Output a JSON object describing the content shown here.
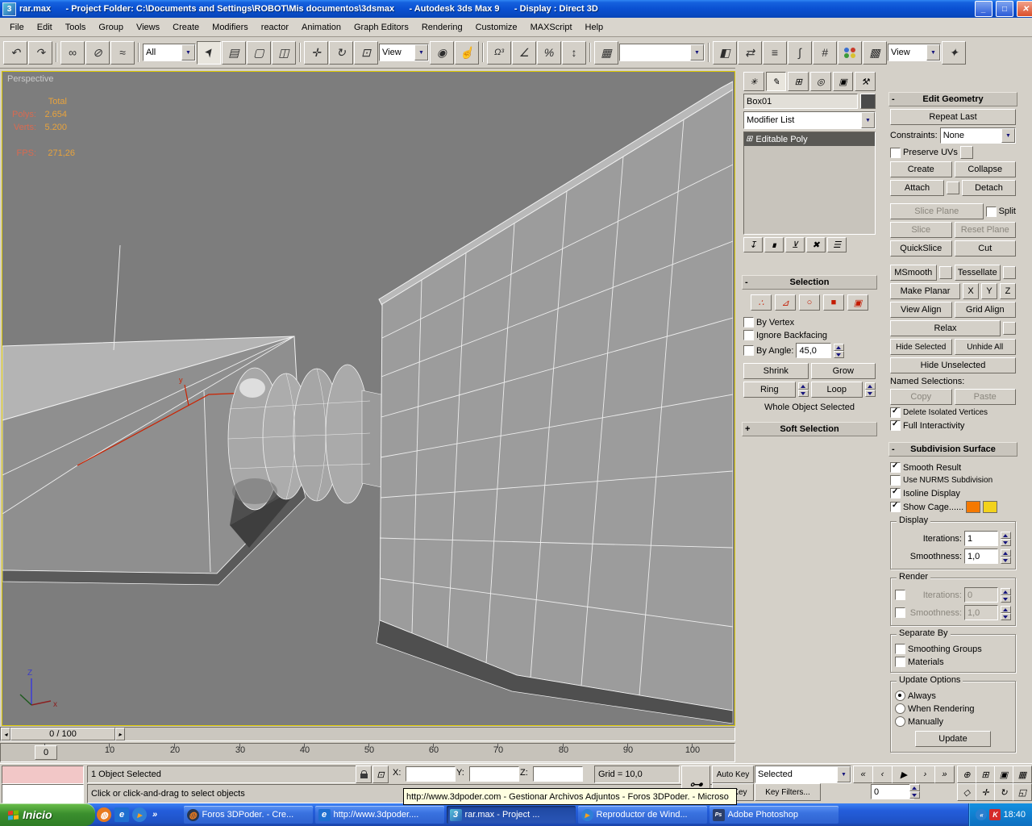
{
  "window": {
    "title": "rar.max      - Project Folder: C:\\Documents and Settings\\ROBOT\\Mis documentos\\3dsmax      - Autodesk 3ds Max 9      - Display : Direct 3D"
  },
  "icons": {
    "app": "3",
    "minimize": "_",
    "maximize": "□",
    "close": "✕",
    "undo": "↶",
    "redo": "↷",
    "select_link": "∞",
    "unlink": "⊘",
    "bind_spacewarp": "≈",
    "select": "➤",
    "select_by_name": "▤",
    "region": "▢",
    "window_crossing": "◫",
    "move": "✛",
    "rotate": "↻",
    "scale": "⊡",
    "use_center": "◉",
    "manipulate": "☝",
    "snap": "Ω³",
    "angle_snap": "∠",
    "percent_snap": "%",
    "spinner_snap": "↕",
    "named_sets": "▦",
    "mirror": "◧",
    "align": "⇄",
    "layers": "≡",
    "curve_editor": "∫",
    "schematic": "#",
    "render_setup": "▩",
    "quick_render": "✦",
    "arrow": "▼",
    "tab_create": "✳",
    "tab_modify": "✎",
    "tab_hierarchy": "⊞",
    "tab_motion": "◎",
    "tab_display": "▣",
    "tab_utilities": "⚒",
    "pin_stack": "↧",
    "show_end_result": "∎",
    "make_unique": "⊻",
    "remove_modifier": "✖",
    "configure_sets": "☰",
    "stack_item_icon": "⊞",
    "so_vertex": "∴",
    "so_edge": "⊿",
    "so_border": "○",
    "so_polygon": "■",
    "so_element": "▣",
    "go_start": "«",
    "prev_frame": "‹",
    "play": "▶",
    "next_frame": "›",
    "go_end": "»",
    "zoom": "⊕",
    "zoom_all": "⊞",
    "zoom_extents": "▣",
    "zoom_extents_all": "▦",
    "fov": "◇",
    "pan": "✛",
    "arc_rotate": "↻",
    "min_max": "◱",
    "set_key_glyph": "⊶",
    "absolute_mode": "⊡",
    "slider_left": "◂",
    "slider_right": "▸",
    "tray_chevron": "«",
    "quick_chevron": "»",
    "ie": "e",
    "wmp": "▸",
    "ps": "Ps",
    "max_app": "3",
    "ff": "◍",
    "red_k": "K"
  },
  "menubar": {
    "items": [
      "File",
      "Edit",
      "Tools",
      "Group",
      "Views",
      "Create",
      "Modifiers",
      "reactor",
      "Animation",
      "Graph Editors",
      "Rendering",
      "Customize",
      "MAXScript",
      "Help"
    ]
  },
  "toolbar": {
    "selection_filter": "All",
    "coordsys": "View",
    "named_selection": "",
    "render_type": "View"
  },
  "viewport": {
    "label": "Perspective",
    "stats": {
      "total_label": "Total",
      "polys_label": "Polys:",
      "polys_value": "2.654",
      "verts_label": "Verts:",
      "verts_value": "5.200",
      "fps_label": "FPS:",
      "fps_value": "271,26"
    },
    "axis": {
      "x": "x",
      "y": "y",
      "z": "Z"
    }
  },
  "command_panel": {
    "object_name": "Box01",
    "modifier_list": "Modifier List",
    "stack_item": "Editable Poly",
    "selection": {
      "title": "Selection",
      "by_vertex": "By Vertex",
      "ignore_backfacing": "Ignore Backfacing",
      "by_angle": "By Angle:",
      "angle_value": "45,0",
      "shrink": "Shrink",
      "grow": "Grow",
      "ring": "Ring",
      "loop": "Loop",
      "status": "Whole Object Selected"
    },
    "soft_selection": {
      "title": "Soft Selection"
    },
    "edit_geometry": {
      "title": "Edit Geometry",
      "repeat_last": "Repeat Last",
      "constraints_label": "Constraints:",
      "constraints_value": "None",
      "preserve_uvs": "Preserve UVs",
      "create": "Create",
      "collapse": "Collapse",
      "attach": "Attach",
      "detach": "Detach",
      "slice_plane": "Slice Plane",
      "split": "Split",
      "slice": "Slice",
      "reset_plane": "Reset Plane",
      "quickslice": "QuickSlice",
      "cut": "Cut",
      "msmooth": "MSmooth",
      "tessellate": "Tessellate",
      "make_planar": "Make Planar",
      "x": "X",
      "y": "Y",
      "z": "Z",
      "view_align": "View Align",
      "grid_align": "Grid Align",
      "relax": "Relax",
      "hide_selected": "Hide Selected",
      "unhide_all": "Unhide All",
      "hide_unselected": "Hide Unselected",
      "named_selections": "Named Selections:",
      "copy": "Copy",
      "paste": "Paste",
      "delete_isolated": "Delete Isolated Vertices",
      "full_interactivity": "Full Interactivity"
    },
    "subdivision": {
      "title": "Subdivision Surface",
      "smooth_result": "Smooth Result",
      "use_nurms": "Use NURMS Subdivision",
      "isoline_display": "Isoline Display",
      "show_cage": "Show Cage......",
      "display_group": "Display",
      "render_group": "Render",
      "iterations_label": "Iterations:",
      "smoothness_label": "Smoothness:",
      "display_iterations": "1",
      "display_smoothness": "1,0",
      "render_iterations": "0",
      "render_smoothness": "1,0",
      "separate_by": "Separate By",
      "smoothing_groups": "Smoothing Groups",
      "materials": "Materials",
      "update_options": "Update Options",
      "always": "Always",
      "when_rendering": "When Rendering",
      "manually": "Manually",
      "update": "Update"
    }
  },
  "timeline": {
    "slider_label": "0 / 100",
    "frame_indicator": "0",
    "ticks": [
      "0",
      "10",
      "20",
      "30",
      "40",
      "50",
      "60",
      "70",
      "80",
      "90",
      "100"
    ]
  },
  "statusbar": {
    "selection_status": "1 Object Selected",
    "prompt": "Click or click-and-drag to select objects",
    "x_label": "X:",
    "y_label": "Y:",
    "z_label": "Z:",
    "x_value": "",
    "y_value": "",
    "z_value": "",
    "grid_label": "Grid = 10,0",
    "auto_key": "Auto Key",
    "set_key": "Set Key",
    "selection_set": "Selected",
    "key_filters": "Key Filters...",
    "frame_value": "0"
  },
  "tooltip": {
    "text": "http://www.3dpoder.com - Gestionar Archivos Adjuntos - Foros 3DPoder. - Microso"
  },
  "taskbar": {
    "start_label": "Inicio",
    "tasks": [
      {
        "label": "Foros 3DPoder. - Cre..."
      },
      {
        "label": "http://www.3dpoder...."
      },
      {
        "label": "rar.max    - Project ..."
      },
      {
        "label": "Reproductor de Wind..."
      },
      {
        "label": "Adobe Photoshop"
      }
    ],
    "clock": "18:40"
  },
  "colors": {
    "viewport_border": "#DCC800",
    "cage_color_1": "#F57900",
    "cage_color_2": "#F2D21C",
    "object_color": "#4A4A4A",
    "stats_label": "#D96A50",
    "stats_value": "#E8A33C",
    "subobject_icon": "#C41A00"
  }
}
